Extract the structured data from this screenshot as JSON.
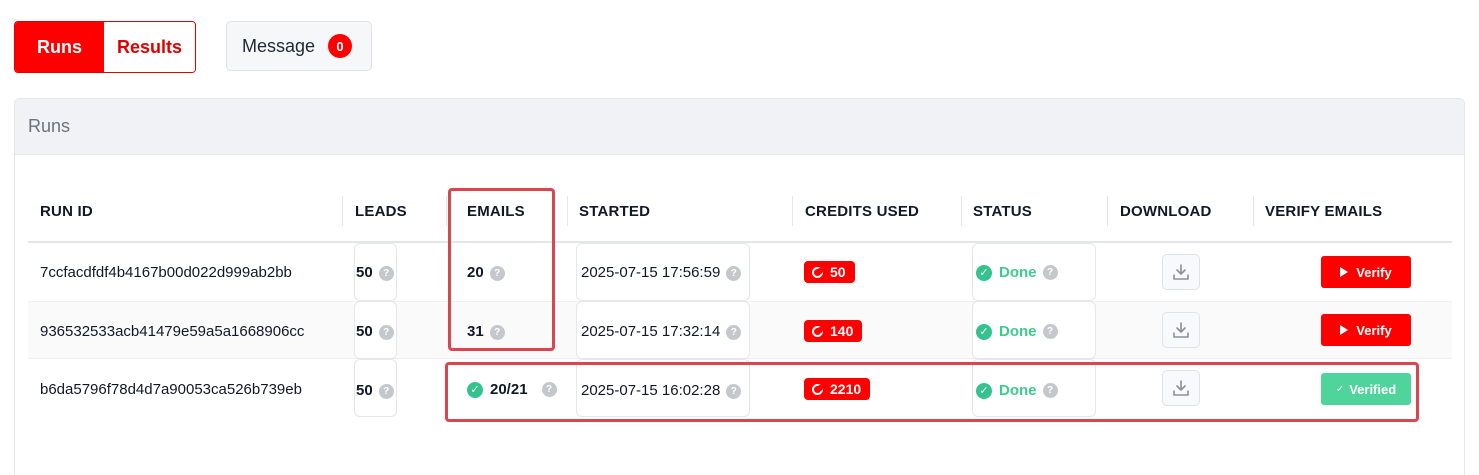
{
  "tabs": {
    "runs": "Runs",
    "results": "Results"
  },
  "message": {
    "label": "Message",
    "count": "0"
  },
  "card": {
    "title": "Runs"
  },
  "columns": {
    "run_id": "RUN ID",
    "leads": "LEADS",
    "emails": "EMAILS",
    "started": "STARTED",
    "credits": "CREDITS USED",
    "status": "STATUS",
    "download": "DOWNLOAD",
    "verify": "VERIFY EMAILS"
  },
  "help_glyph": "?",
  "rows": [
    {
      "run_id": "7ccfacdfdf4b4167b00d022d999ab2bb",
      "leads": "50",
      "emails": "20",
      "started": "2025-07-15 17:56:59",
      "credits": "50",
      "status": "Done",
      "verify_label": "Verify"
    },
    {
      "run_id": "936532533acb41479e59a5a1668906cc",
      "leads": "50",
      "emails": "31",
      "started": "2025-07-15 17:32:14",
      "credits": "140",
      "status": "Done",
      "verify_label": "Verify"
    },
    {
      "run_id": "b6da5796f78d4d7a90053ca526b739eb",
      "leads": "50",
      "emails": "20/21",
      "started": "2025-07-15 16:02:28",
      "credits": "2210",
      "status": "Done",
      "verify_label": "Verified"
    }
  ],
  "colors": {
    "accent": "#ff0000",
    "success": "#3ecb8e",
    "highlight": "#d9464f"
  },
  "icons": [
    "help-icon",
    "credit-icon",
    "check-circle-icon",
    "download-icon",
    "play-icon",
    "check-icon"
  ]
}
